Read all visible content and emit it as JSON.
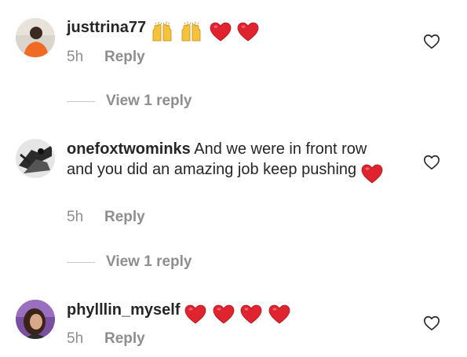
{
  "comments": [
    {
      "username": "justtrina77",
      "text": "",
      "emoji": [
        "raising-hands",
        "raising-hands",
        "red-heart",
        "red-heart"
      ],
      "time": "5h",
      "reply_label": "Reply",
      "view_replies": "View 1 reply"
    },
    {
      "username": "onefoxtwominks",
      "text": "And we were in front row and you did an amazing job keep pushing",
      "emoji": [
        "red-heart"
      ],
      "time": "5h",
      "reply_label": "Reply",
      "view_replies": "View 1 reply"
    },
    {
      "username": "phylllin_myself",
      "text": "",
      "emoji": [
        "red-heart",
        "red-heart",
        "red-heart",
        "red-heart"
      ],
      "time": "5h",
      "reply_label": "Reply"
    }
  ],
  "colors": {
    "text": "#262626",
    "secondary": "#8e8e8e",
    "heart": "#e0242f",
    "divider": "#c7c7c7"
  }
}
